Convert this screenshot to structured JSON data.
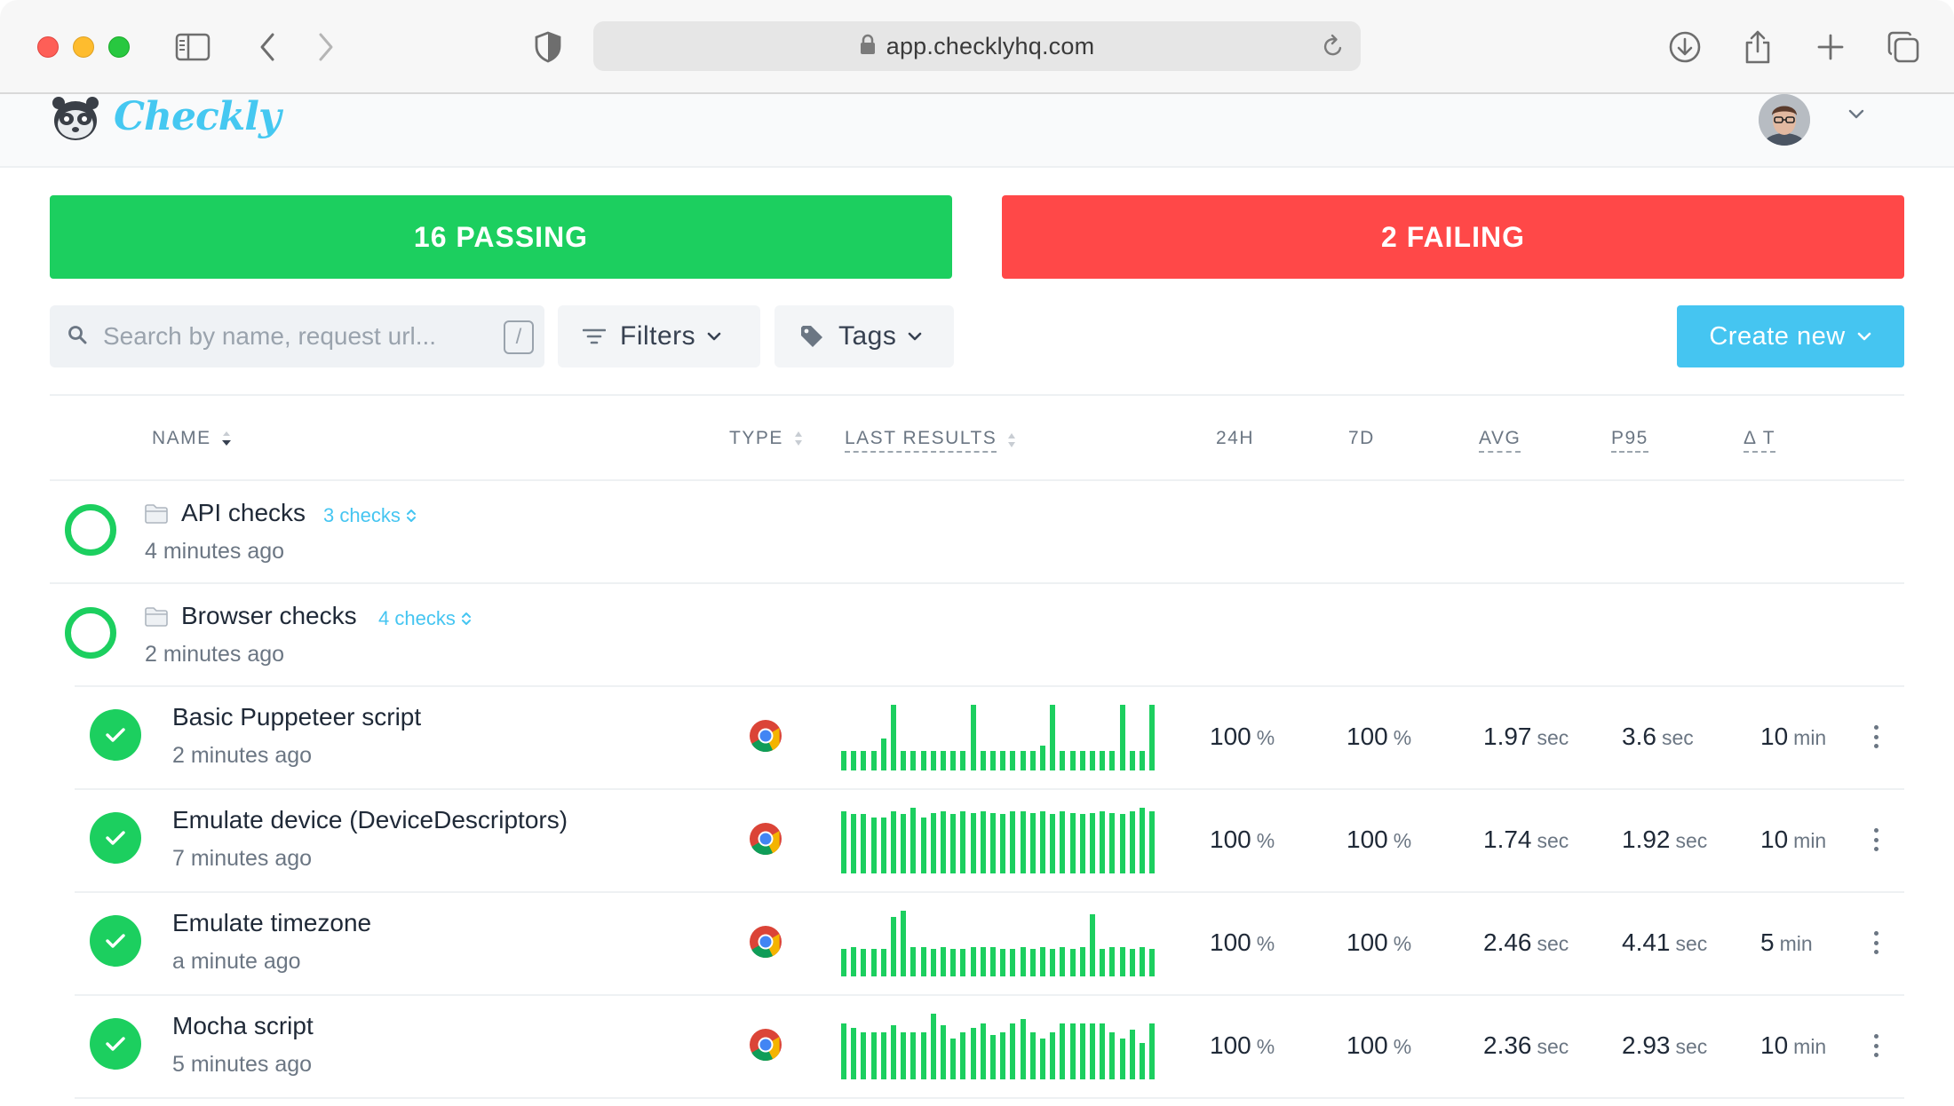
{
  "browser": {
    "url": "app.checklyhq.com",
    "icons": [
      "sidebar-icon",
      "back-icon",
      "forward-icon",
      "shield-icon",
      "lock-icon",
      "reload-icon",
      "download-icon",
      "share-icon",
      "new-tab-icon",
      "tabs-overview-icon"
    ]
  },
  "header": {
    "brand": "Checkly"
  },
  "summary": {
    "passing": "16 PASSING",
    "failing": "2 FAILING"
  },
  "filterbar": {
    "search_placeholder": "Search by name, request url...",
    "search_shortcut": "/",
    "filters_label": "Filters",
    "tags_label": "Tags",
    "create_label": "Create new"
  },
  "table": {
    "headers": {
      "name": "NAME",
      "type": "TYPE",
      "last_results": "LAST RESULTS",
      "h24": "24H",
      "d7": "7D",
      "avg": "AVG",
      "p95": "P95",
      "delta_t": "Δ T"
    },
    "groups": [
      {
        "name": "API checks",
        "count": "3 checks",
        "updated": "4 minutes ago"
      },
      {
        "name": "Browser checks",
        "count": "4 checks",
        "updated": "2 minutes ago"
      }
    ],
    "checks": [
      {
        "name": "Basic Puppeteer script",
        "updated": "2 minutes ago",
        "type": "chrome-icon",
        "h24": "100",
        "h24_unit": "%",
        "d7": "100",
        "d7_unit": "%",
        "avg": "1.97",
        "avg_unit": "sec",
        "p95": "3.6",
        "p95_unit": "sec",
        "delta": "10",
        "delta_unit": "min",
        "last_results": [
          0.3,
          0.3,
          0.3,
          0.3,
          0.48,
          1.0,
          0.3,
          0.3,
          0.3,
          0.3,
          0.3,
          0.3,
          0.3,
          1.0,
          0.3,
          0.3,
          0.3,
          0.3,
          0.3,
          0.3,
          0.38,
          1.0,
          0.3,
          0.3,
          0.3,
          0.3,
          0.3,
          0.3,
          1.0,
          0.3,
          0.3,
          1.0
        ]
      },
      {
        "name": "Emulate device (DeviceDescriptors)",
        "updated": "7 minutes ago",
        "type": "chrome-icon",
        "h24": "100",
        "h24_unit": "%",
        "d7": "100",
        "d7_unit": "%",
        "avg": "1.74",
        "avg_unit": "sec",
        "p95": "1.92",
        "p95_unit": "sec",
        "delta": "10",
        "delta_unit": "min",
        "last_results": [
          0.95,
          0.9,
          0.9,
          0.85,
          0.85,
          0.95,
          0.9,
          1.0,
          0.85,
          0.92,
          0.95,
          0.9,
          0.95,
          0.92,
          0.95,
          0.92,
          0.9,
          0.95,
          0.95,
          0.92,
          0.95,
          0.9,
          0.95,
          0.92,
          0.9,
          0.92,
          0.95,
          0.92,
          0.9,
          0.95,
          1.0,
          0.95
        ]
      },
      {
        "name": "Emulate timezone",
        "updated": "a minute ago",
        "type": "chrome-icon",
        "h24": "100",
        "h24_unit": "%",
        "d7": "100",
        "d7_unit": "%",
        "avg": "2.46",
        "avg_unit": "sec",
        "p95": "4.41",
        "p95_unit": "sec",
        "delta": "5",
        "delta_unit": "min",
        "last_results": [
          0.42,
          0.45,
          0.42,
          0.42,
          0.42,
          0.9,
          1.0,
          0.45,
          0.45,
          0.42,
          0.45,
          0.42,
          0.42,
          0.45,
          0.45,
          0.45,
          0.42,
          0.42,
          0.45,
          0.42,
          0.45,
          0.42,
          0.45,
          0.42,
          0.45,
          0.95,
          0.42,
          0.45,
          0.45,
          0.42,
          0.45,
          0.42
        ]
      },
      {
        "name": "Mocha script",
        "updated": "5 minutes ago",
        "type": "chrome-icon",
        "h24": "100",
        "h24_unit": "%",
        "d7": "100",
        "d7_unit": "%",
        "avg": "2.36",
        "avg_unit": "sec",
        "p95": "2.93",
        "p95_unit": "sec",
        "delta": "10",
        "delta_unit": "min",
        "last_results": [
          0.85,
          0.78,
          0.72,
          0.72,
          0.72,
          0.82,
          0.72,
          0.72,
          0.72,
          1.0,
          0.82,
          0.62,
          0.72,
          0.78,
          0.85,
          0.68,
          0.72,
          0.85,
          0.92,
          0.72,
          0.62,
          0.72,
          0.85,
          0.85,
          0.85,
          0.85,
          0.85,
          0.72,
          0.62,
          0.75,
          0.55,
          0.85
        ]
      }
    ]
  },
  "colors": {
    "passing": "#1ccf5f",
    "failing": "#ff4848",
    "accent": "#45c5f1"
  }
}
